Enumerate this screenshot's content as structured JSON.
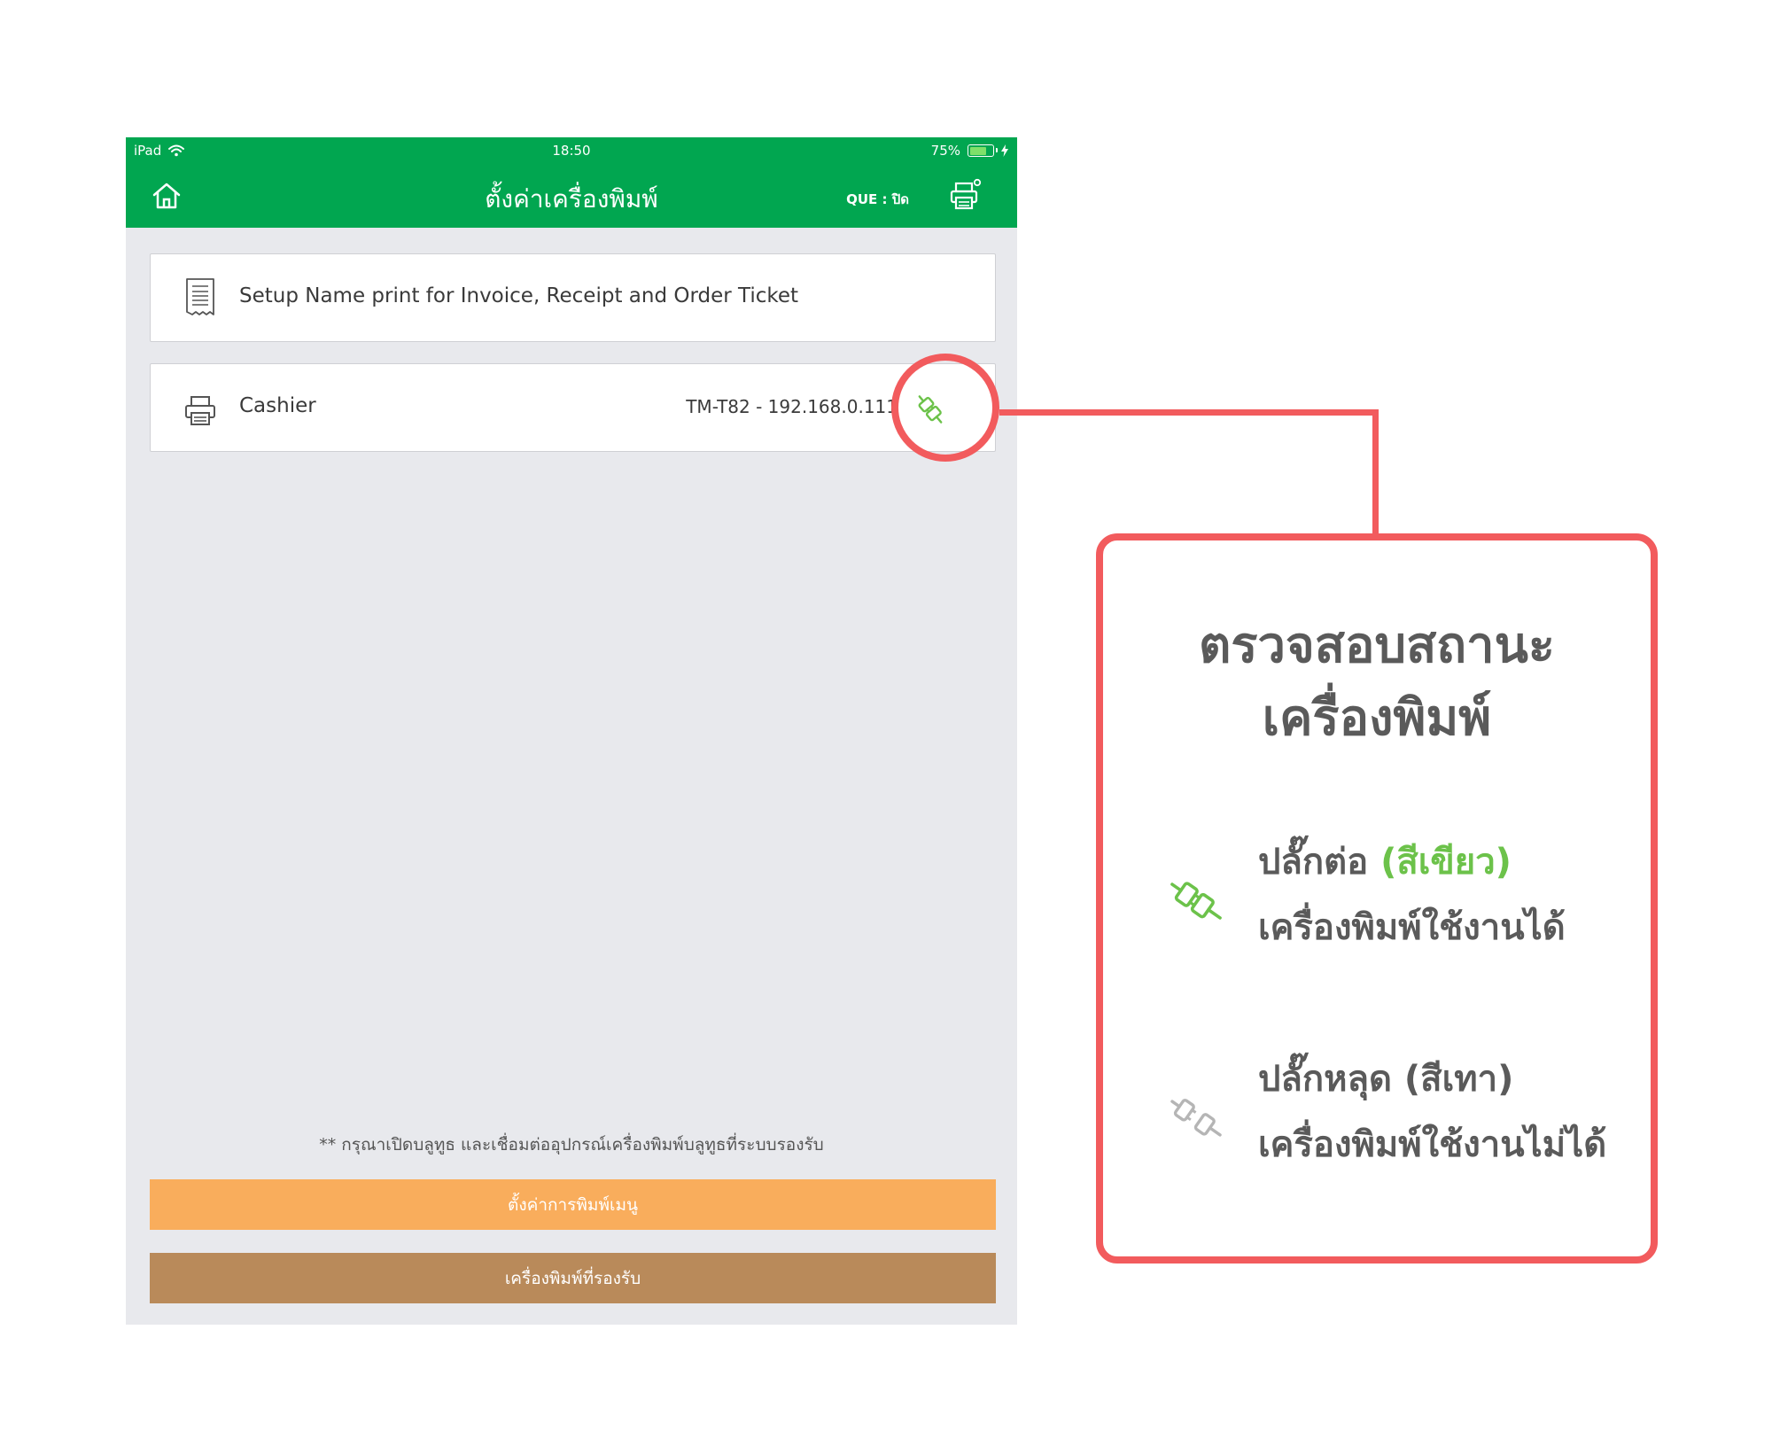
{
  "status_bar": {
    "device": "iPad",
    "time": "18:50",
    "battery": "75%",
    "battery_level": 0.75
  },
  "nav": {
    "title": "ตั้งค่าเครื่องพิมพ์",
    "que_label": "QUE : ปิด"
  },
  "cards": {
    "setup_name": {
      "label": "Setup Name print for Invoice, Receipt and Order Ticket"
    },
    "cashier": {
      "label": "Cashier",
      "value": "TM-T82 - 192.168.0.111"
    }
  },
  "notice": "** กรุณาเปิดบลูทูธ และเชื่อมต่ออุปกรณ์เครื่องพิมพ์บลูทูธที่ระบบรองรับ",
  "buttons": {
    "menu_print": "ตั้งค่าการพิมพ์เมนู",
    "supported_printers": "เครื่องพิมพ์ที่รองรับ"
  },
  "legend": {
    "title_line1": "ตรวจสอบสถานะ",
    "title_line2": "เครื่องพิมพ์",
    "connected": {
      "label": "ปลั๊กต่อ",
      "color_note": "(สีเขียว)",
      "description": "เครื่องพิมพ์ใช้งานได้"
    },
    "disconnected": {
      "label": "ปลั๊กหลุด (สีเทา)",
      "description": "เครื่องพิมพ์ใช้งานไม่ได้"
    }
  },
  "colors": {
    "brand_green": "#01a650",
    "plug_green": "#6cc24a",
    "plug_gray": "#b5b5b5",
    "highlight_red": "#f25b5d",
    "button_orange": "#f9ad5c",
    "button_brown": "#b98a5a",
    "background_gray": "#e8e9ed"
  },
  "icons": {
    "home": "home-icon",
    "printer_settings": "printer-settings-icon",
    "receipt": "receipt-icon",
    "printer": "printer-icon",
    "plug_connected": "plug-connected-icon",
    "plug_disconnected": "plug-disconnected-icon",
    "wifi": "wifi-icon",
    "battery": "battery-icon",
    "charging": "charging-icon"
  }
}
